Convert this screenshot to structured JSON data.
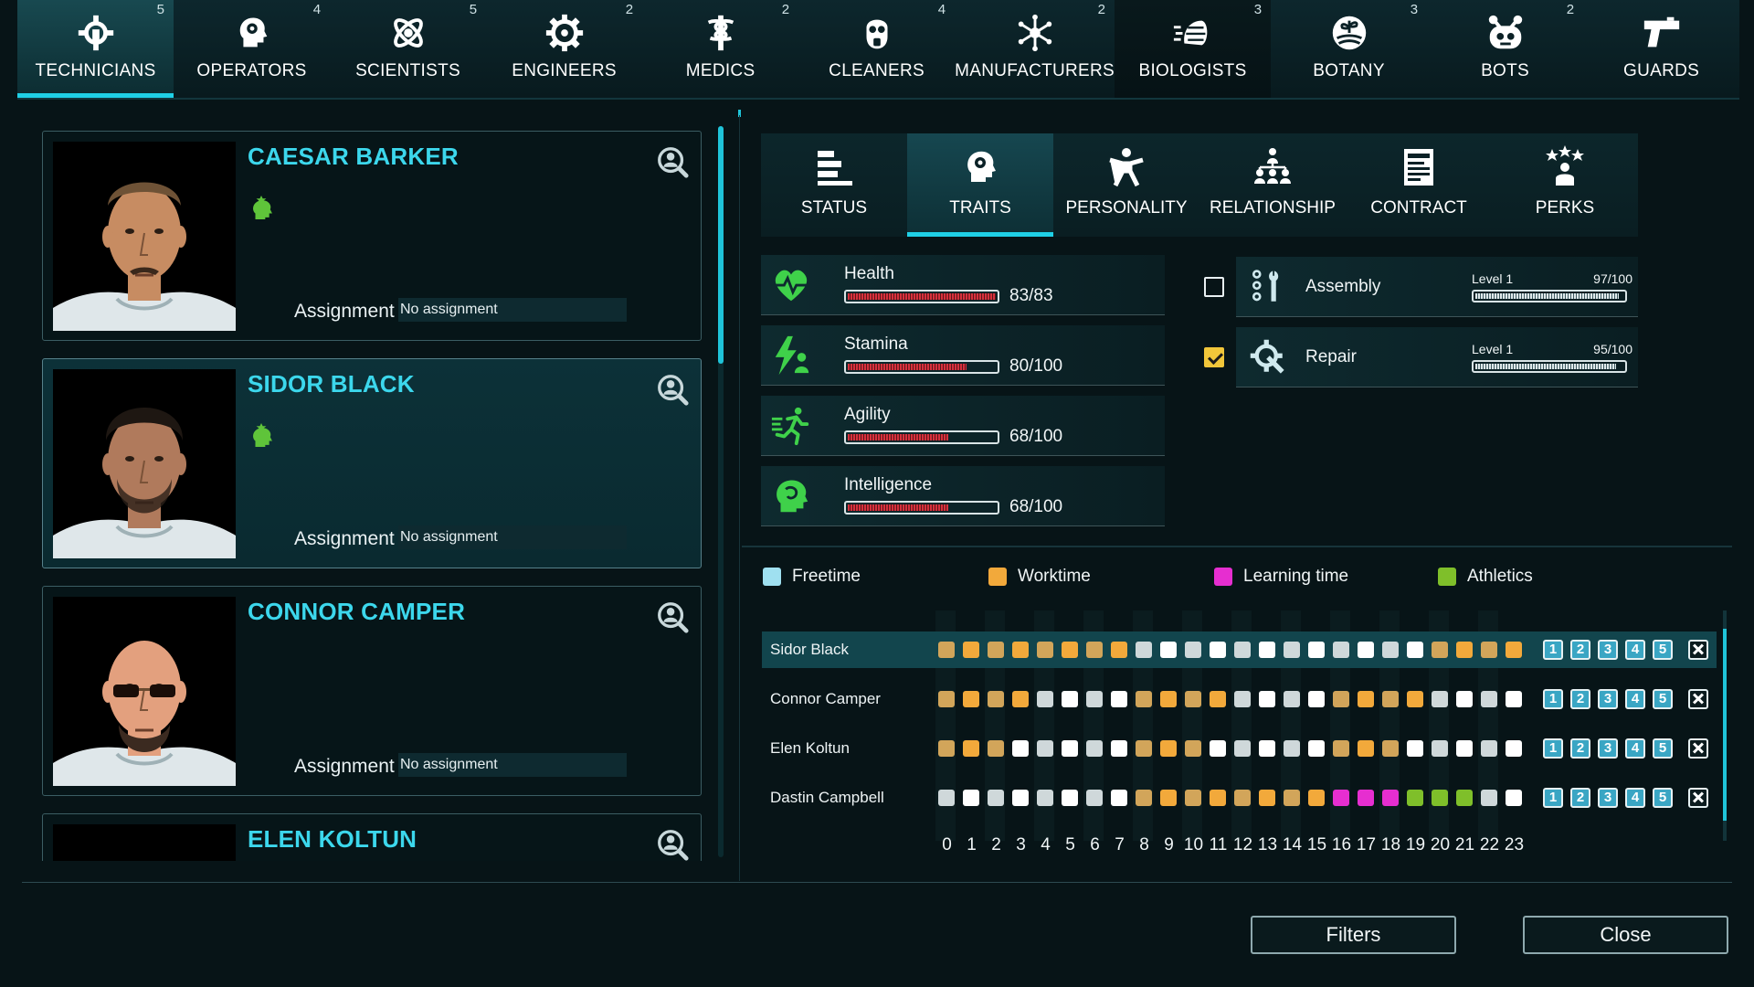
{
  "categories": [
    {
      "label": "TECHNICIANS",
      "count": "5",
      "icon": "gear-wrench-icon",
      "active": true
    },
    {
      "label": "OPERATORS",
      "count": "4",
      "icon": "head-gear-icon"
    },
    {
      "label": "SCIENTISTS",
      "count": "5",
      "icon": "atom-icon"
    },
    {
      "label": "ENGINEERS",
      "count": "2",
      "icon": "cog-icon"
    },
    {
      "label": "MEDICS",
      "count": "2",
      "icon": "caduceus-icon"
    },
    {
      "label": "CLEANERS",
      "count": "4",
      "icon": "gas-mask-icon"
    },
    {
      "label": "MANUFACTURERS",
      "count": "2",
      "icon": "molecule-icon"
    },
    {
      "label": "BIOLOGISTS",
      "count": "3",
      "icon": "hand-spray-icon"
    },
    {
      "label": "BOTANY",
      "count": "3",
      "icon": "plant-icon"
    },
    {
      "label": "BOTS",
      "count": "2",
      "icon": "robot-icon"
    },
    {
      "label": "GUARDS",
      "count": "",
      "icon": "pistol-icon"
    }
  ],
  "roster": [
    {
      "name": "CAESAR BARKER",
      "assignment_label": "Assignment",
      "assignment": "No assignment",
      "has_trait": true,
      "portrait": "short-hair-mustache"
    },
    {
      "name": "SIDOR BLACK",
      "assignment_label": "Assignment",
      "assignment": "No assignment",
      "has_trait": true,
      "selected": true,
      "portrait": "dark-hair-beard"
    },
    {
      "name": "CONNOR CAMPER",
      "assignment_label": "Assignment",
      "assignment": "No assignment",
      "has_trait": false,
      "portrait": "bald-sunglasses"
    },
    {
      "name": "ELEN KOLTUN",
      "assignment_label": "",
      "assignment": "",
      "has_trait": false,
      "portrait": "bald"
    }
  ],
  "detail_tabs": [
    {
      "label": "STATUS",
      "icon": "status-bars-icon"
    },
    {
      "label": "TRAITS",
      "icon": "head-gear-icon",
      "active": true
    },
    {
      "label": "PERSONALITY",
      "icon": "person-icon"
    },
    {
      "label": "RELATIONSHIP",
      "icon": "people-network-icon"
    },
    {
      "label": "CONTRACT",
      "icon": "document-icon"
    },
    {
      "label": "PERKS",
      "icon": "star-person-icon"
    }
  ],
  "stats": [
    {
      "name": "Health",
      "value": "83/83",
      "fraction": 1.0,
      "icon": "heart-pulse-icon"
    },
    {
      "name": "Stamina",
      "value": "80/100",
      "fraction": 0.8,
      "icon": "bolt-person-icon"
    },
    {
      "name": "Agility",
      "value": "68/100",
      "fraction": 0.68,
      "icon": "running-icon"
    },
    {
      "name": "Intelligence",
      "value": "68/100",
      "fraction": 0.68,
      "icon": "brain-head-icon"
    }
  ],
  "skills": [
    {
      "name": "Assembly",
      "level": "Level 1",
      "xp": "97/100",
      "fraction": 0.97,
      "checked": false,
      "icon": "assembly-tools-icon"
    },
    {
      "name": "Repair",
      "level": "Level 1",
      "xp": "95/100",
      "fraction": 0.95,
      "checked": true,
      "icon": "repair-gear-icon"
    }
  ],
  "legend": [
    {
      "label": "Freetime",
      "color": "#9fe0f0"
    },
    {
      "label": "Worktime",
      "color": "#f2a93b"
    },
    {
      "label": "Learning time",
      "color": "#e62ed0"
    },
    {
      "label": "Athletics",
      "color": "#7fbf2a"
    }
  ],
  "schedule": {
    "hours": [
      "0",
      "1",
      "2",
      "3",
      "4",
      "5",
      "6",
      "7",
      "8",
      "9",
      "10",
      "11",
      "12",
      "13",
      "14",
      "15",
      "16",
      "17",
      "18",
      "19",
      "20",
      "21",
      "22",
      "23"
    ],
    "preset_buttons": [
      "1",
      "2",
      "3",
      "4",
      "5"
    ],
    "rows": [
      {
        "name": "Sidor Black",
        "selected": true,
        "slots": "WWWWWWWWFFFFFFFFFFFFWWWW"
      },
      {
        "name": "Connor Camper",
        "slots": "WWWWFFFFWWWWFFFFWWWWFFFF"
      },
      {
        "name": "Elen Koltun",
        "slots": "WWWFFFFFWWWFFFFFWWWFFFFF"
      },
      {
        "name": "Dastin Campbell",
        "slots": "FFFFFFFFWWWWWWWWLLLAAAFF"
      }
    ]
  },
  "buttons": {
    "filters": "Filters",
    "close": "Close"
  },
  "colors": {
    "accent": "#1fd0e6",
    "name_cyan": "#3cd7ec",
    "stat_bar": "#d7313d",
    "stat_icon_green": "#3fd14a",
    "freetime_alt": "#e6eced",
    "worktime_alt": "#d2a55a"
  }
}
